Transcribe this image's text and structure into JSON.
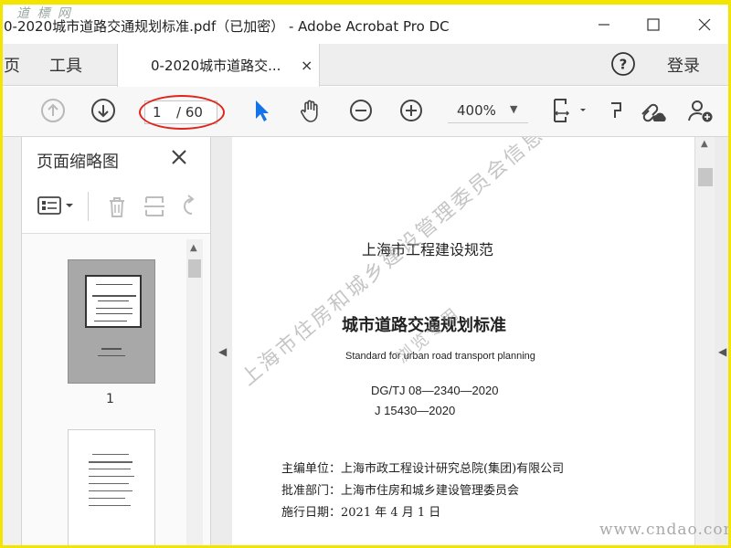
{
  "watermark_top": "道 標 网",
  "window_title": "0-2020城市道路交通规划标准.pdf（已加密） - Adobe Acrobat Pro DC",
  "nav": {
    "home": "页",
    "tools": "工具"
  },
  "doc_tab": {
    "label": "0-2020城市道路交...",
    "close": "×"
  },
  "login_label": "登录",
  "page_nav": {
    "current": "1",
    "total": "/ 60"
  },
  "zoom": {
    "value": "400%"
  },
  "thumb_panel": {
    "title": "页面缩略图",
    "page_label": "1"
  },
  "document": {
    "line1": "上海市工程建设规范",
    "line2": "城市道路交通规划标准",
    "line3": "Standard for urban road transport planning",
    "line4": "DG/TJ 08—2340—2020",
    "line5": "J 15430—2020",
    "line6": "主编单位：上海市政工程设计研究总院(集团)有限公司",
    "line7": "批准部门：上海市住房和城乡建设管理委员会",
    "line8": "施行日期：2021 年 4 月 1 日",
    "watermark_a": "上海市住房和城乡建设管理委员会信息公共",
    "watermark_b": "浏览专用"
  },
  "watermark_bottom": "www.cndao.com",
  "colors": {
    "frame": "#f3e500",
    "accent_blue": "#1473e6",
    "ellipse_red": "#e0241b"
  }
}
